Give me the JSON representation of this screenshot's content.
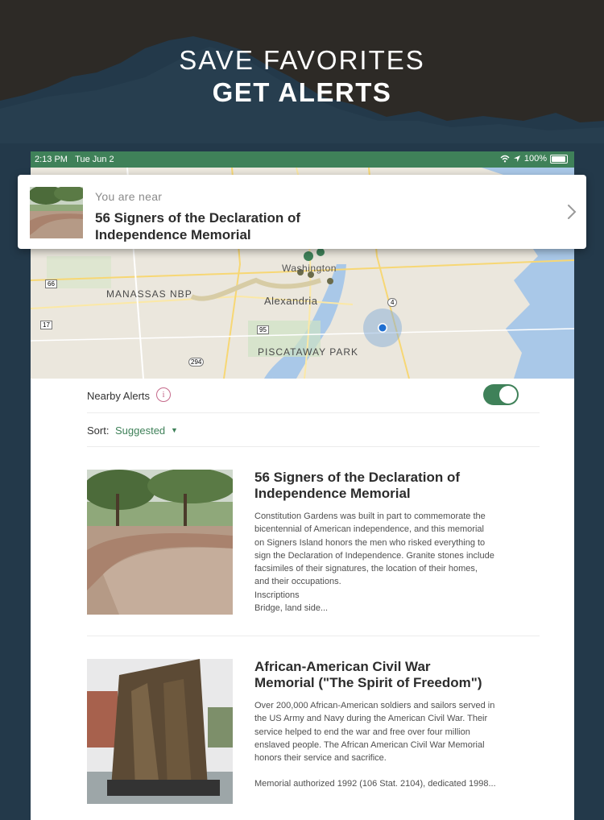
{
  "headline": {
    "line1": "SAVE FAVORITES",
    "line2": "GET ALERTS"
  },
  "status_bar": {
    "time": "2:13 PM",
    "date": "Tue Jun 2",
    "battery": "100%"
  },
  "map": {
    "labels": [
      "MANASSAS NBP",
      "Alexandria",
      "PISCATAWAY PARK",
      "Washington"
    ],
    "route_shields": [
      "66",
      "17",
      "95",
      "294",
      "4"
    ]
  },
  "near_card": {
    "subtitle": "You are near",
    "title": "56 Signers of the Declaration of Independence Memorial"
  },
  "nearby_alerts": {
    "label": "Nearby Alerts",
    "enabled": true
  },
  "sort": {
    "label": "Sort:",
    "value": "Suggested"
  },
  "items": [
    {
      "title": "56 Signers of the Declaration of Independence Memorial",
      "description_lines": [
        "Constitution Gardens was built in part to commemorate the",
        "bicentennial of American independence, and this memorial",
        "on Signers Island honors the men who risked everything to",
        "sign the Declaration of Independence. Granite stones include",
        "facsimiles of their signatures, the location of their homes,",
        "and their occupations.",
        "Inscriptions",
        "Bridge, land side..."
      ]
    },
    {
      "title": "African-American Civil War Memorial (\"The Spirit of Freedom\")",
      "description_lines": [
        "Over 200,000 African-American soldiers and sailors served in",
        "the US Army and Navy during the American Civil War. Their",
        "service helped to end the war and free over four million",
        "enslaved people. The African American Civil War Memorial",
        "honors their service and sacrifice.",
        "",
        "Memorial authorized 1992 (106 Stat. 2104), dedicated 1998..."
      ]
    }
  ],
  "colors": {
    "accent_green": "#3f8159",
    "background_navy": "#23394a",
    "background_dark": "#2d2a26"
  }
}
